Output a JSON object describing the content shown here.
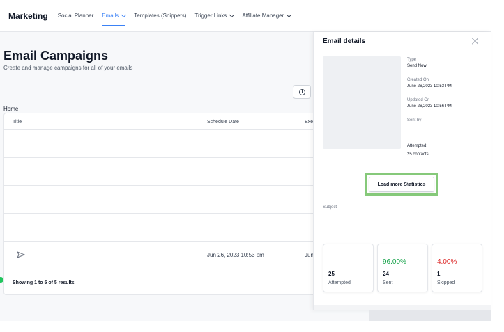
{
  "nav": {
    "brand": "Marketing",
    "items": [
      {
        "label": "Social Planner",
        "active": false,
        "dropdown": false
      },
      {
        "label": "Emails",
        "active": true,
        "dropdown": true
      },
      {
        "label": "Templates (Snippets)",
        "active": false,
        "dropdown": false
      },
      {
        "label": "Trigger Links",
        "active": false,
        "dropdown": true
      },
      {
        "label": "Affiliate Manager",
        "active": false,
        "dropdown": true
      }
    ]
  },
  "page": {
    "title": "Email Campaigns",
    "subtitle": "Create and manage campaigns for all of your emails",
    "breadcrumb": "Home"
  },
  "table": {
    "columns": [
      "Title",
      "Schedule Date",
      "Exec"
    ],
    "last_row": {
      "schedule_date": "Jun 26, 2023 10:53 pm",
      "exec": "Jun"
    },
    "footer": "Showing 1 to 5 of 5 results"
  },
  "drawer": {
    "title": "Email details",
    "meta": {
      "type_label": "Type",
      "type_value": "Send Now",
      "created_label": "Created On",
      "created_value": "June 26,2023 10:53 PM",
      "updated_label": "Updated On",
      "updated_value": "June 26,2023 10:56 PM",
      "sentby_label": "Sent by",
      "attempted_label": "Attempted:",
      "attempted_value": "25 contacts"
    },
    "load_more": "Load more Statistics",
    "subject_label": "Subject",
    "stats": [
      {
        "pct": "",
        "count": "25",
        "label": "Attempted",
        "color": "#111827"
      },
      {
        "pct": "96.00%",
        "count": "24",
        "label": "Sent",
        "color": "#16a34a"
      },
      {
        "pct": "4.00%",
        "count": "1",
        "label": "Skipped",
        "color": "#dc2626"
      }
    ]
  },
  "colors": {
    "accent": "#3b82f6",
    "highlight": "#86c97a"
  }
}
